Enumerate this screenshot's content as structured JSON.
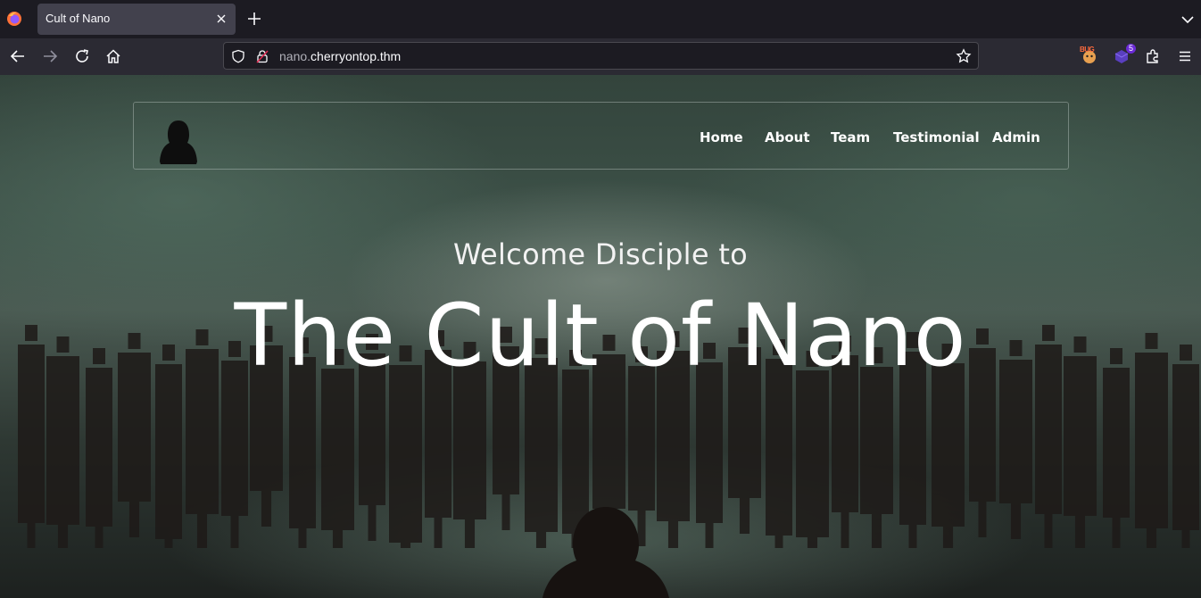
{
  "browser": {
    "tab": {
      "title": "Cult of Nano"
    },
    "url": {
      "dim_prefix": "nano.",
      "domain": "cherryontop.thm"
    },
    "extensions": [
      {
        "name": "bug-extension-icon",
        "label": "BUG"
      },
      {
        "name": "purple-extension-icon",
        "badge": "5"
      }
    ]
  },
  "site": {
    "nav": [
      "Home",
      "About",
      "Team",
      "Testimonial",
      "Admin"
    ],
    "hero": {
      "subtitle": "Welcome Disciple to",
      "title": "The Cult of Nano"
    }
  },
  "colors": {
    "tab_bg": "#42414d",
    "toolbar_bg": "#2b2a33",
    "urlbar_bg": "#1c1b22",
    "text": "#ffffff"
  }
}
